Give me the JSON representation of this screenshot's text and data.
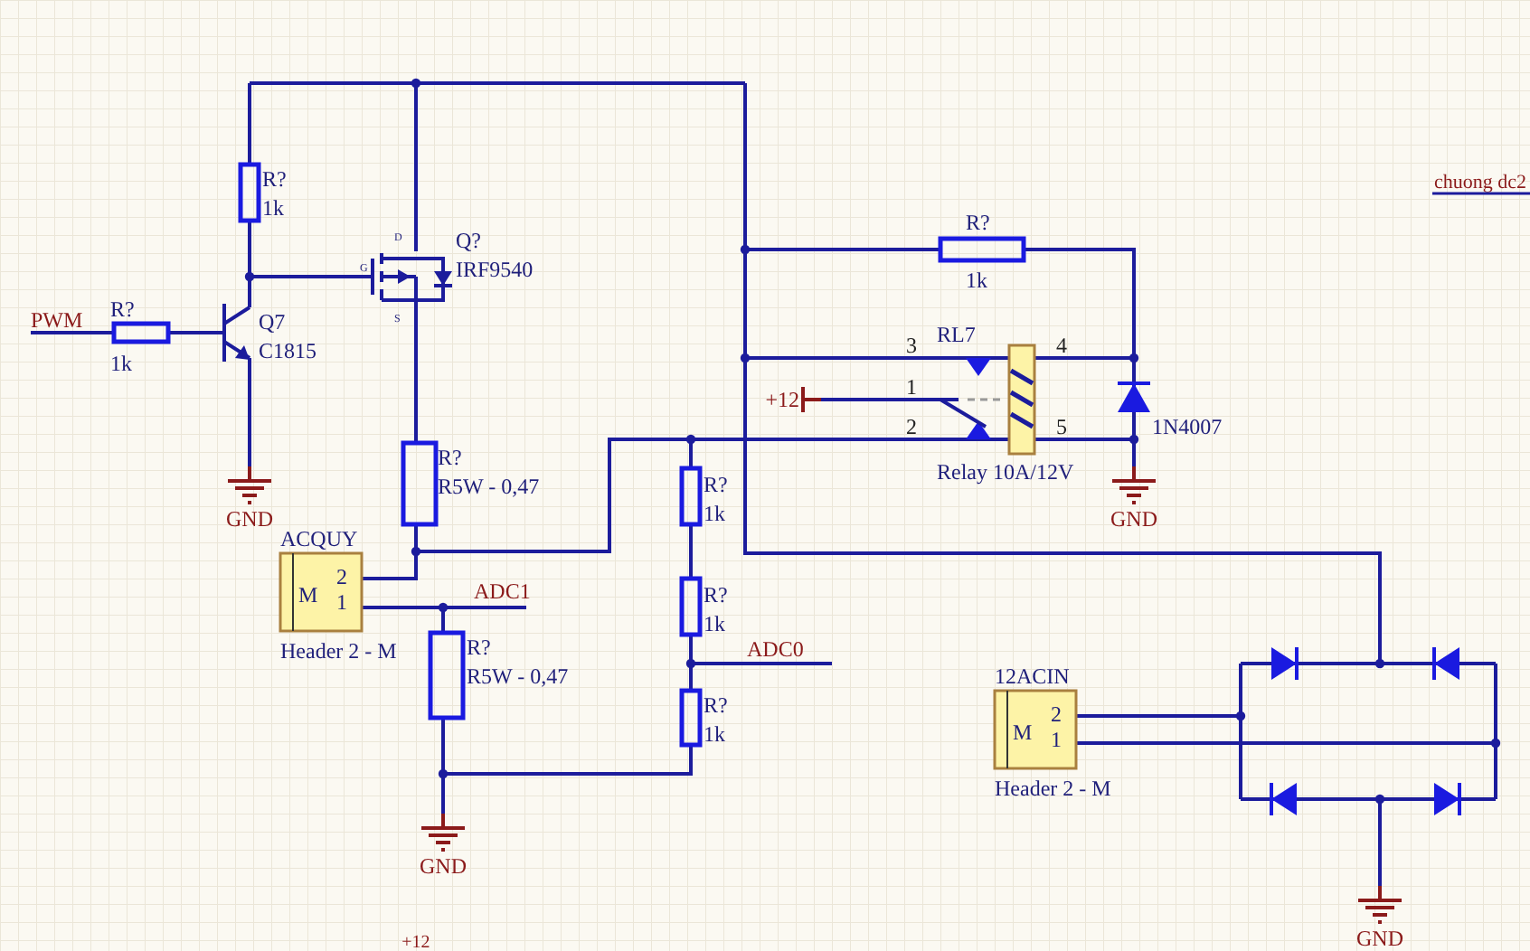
{
  "net_labels": [
    {
      "text": "PWM"
    },
    {
      "text": "ADC1"
    },
    {
      "text": "ADC0"
    },
    {
      "text": "chuong dc2"
    }
  ],
  "power_ports": [
    {
      "kind": "ground",
      "label": "GND"
    },
    {
      "kind": "ground",
      "label": "GND"
    },
    {
      "kind": "ground",
      "label": "GND"
    },
    {
      "kind": "ground",
      "label": "GND"
    },
    {
      "kind": "power",
      "label": "+12"
    },
    {
      "kind": "power",
      "label": "+12"
    }
  ],
  "components": [
    {
      "kind": "resistor",
      "designator": "R?",
      "value": "1k"
    },
    {
      "kind": "resistor",
      "designator": "R?",
      "value": "1k"
    },
    {
      "kind": "npn",
      "designator": "Q7",
      "value": "C1815"
    },
    {
      "kind": "pmos",
      "designator": "Q?",
      "value": "IRF9540",
      "pins": [
        "D",
        "G",
        "S"
      ]
    },
    {
      "kind": "resistor",
      "designator": "R?",
      "value": "R5W - 0,47"
    },
    {
      "kind": "header",
      "designator": "ACQUY",
      "value": "Header 2 - M",
      "body": "M",
      "pins": [
        "2",
        "1"
      ]
    },
    {
      "kind": "resistor",
      "designator": "R?",
      "value": "R5W - 0,47"
    },
    {
      "kind": "resistor",
      "designator": "R?",
      "value": "1k"
    },
    {
      "kind": "resistor",
      "designator": "R?",
      "value": "1k"
    },
    {
      "kind": "resistor",
      "designator": "R?",
      "value": "1k"
    },
    {
      "kind": "resistor",
      "designator": "R?",
      "value": "1k"
    },
    {
      "kind": "relay",
      "designator": "RL7",
      "value": "Relay 10A/12V",
      "pins": [
        "3",
        "1",
        "2",
        "4",
        "5"
      ]
    },
    {
      "kind": "diode",
      "value": "1N4007"
    },
    {
      "kind": "header",
      "designator": "12ACIN",
      "value": "Header 2 - M",
      "body": "M",
      "pins": [
        "2",
        "1"
      ]
    },
    {
      "kind": "bridge"
    }
  ]
}
